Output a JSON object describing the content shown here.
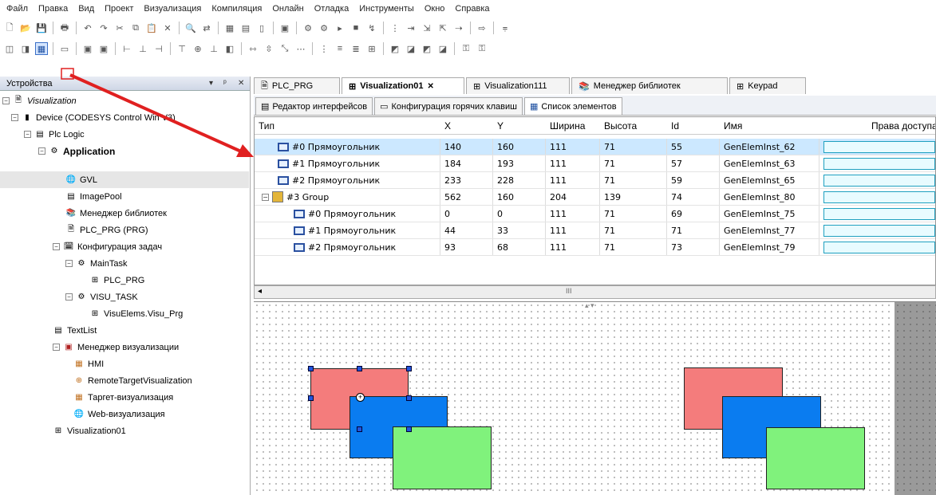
{
  "menu": [
    "Файл",
    "Правка",
    "Вид",
    "Проект",
    "Визуализация",
    "Компиляция",
    "Онлайн",
    "Отладка",
    "Инструменты",
    "Окно",
    "Справка"
  ],
  "sidebar": {
    "title": "Устройства",
    "controls": [
      "▾",
      "ᵖ",
      "✕"
    ],
    "tree": {
      "visualization": "Visualization",
      "device": "Device (CODESYS Control Win V3)",
      "plc_logic": "Plc Logic",
      "application": "Application",
      "gvl": "GVL",
      "imagepool": "ImagePool",
      "lib_manager": "Менеджер библиотек",
      "plc_prg": "PLC_PRG (PRG)",
      "task_config": "Конфигурация задач",
      "maintask": "MainTask",
      "maintask_prg": "PLC_PRG",
      "visu_task": "VISU_TASK",
      "visu_prg": "VisuElems.Visu_Prg",
      "textlist": "TextList",
      "visu_manager": "Менеджер визуализации",
      "hmi": "HMI",
      "remote_target": "RemoteTargetVisualization",
      "target_visu": "Таргет-визуализация",
      "web_visu": "Web-визуализация",
      "visualization01": "Visualization01"
    }
  },
  "tabs": [
    {
      "label": "PLC_PRG"
    },
    {
      "label": "Visualization01",
      "close": "✕"
    },
    {
      "label": "Visualization111"
    },
    {
      "label": "Менеджер библиотек"
    },
    {
      "label": "Keypad"
    }
  ],
  "subtabs": [
    {
      "label": "Редактор интерфейсов"
    },
    {
      "label": "Конфигурация горячих клавиш"
    },
    {
      "label": "Список элементов"
    }
  ],
  "table": {
    "headers": [
      "Тип",
      "X",
      "Y",
      "Ширина",
      "Высота",
      "Id",
      "Имя",
      "Права доступа"
    ],
    "rows": [
      {
        "type": "#0 Прямоугольник",
        "x": "140",
        "y": "160",
        "w": "111",
        "h": "71",
        "id": "55",
        "name": "GenElemInst_62"
      },
      {
        "type": "#1 Прямоугольник",
        "x": "184",
        "y": "193",
        "w": "111",
        "h": "71",
        "id": "57",
        "name": "GenElemInst_63"
      },
      {
        "type": "#2 Прямоугольник",
        "x": "233",
        "y": "228",
        "w": "111",
        "h": "71",
        "id": "59",
        "name": "GenElemInst_65"
      },
      {
        "type": "#3 Group",
        "x": "562",
        "y": "160",
        "w": "204",
        "h": "139",
        "id": "74",
        "name": "GenElemInst_80"
      },
      {
        "type": "#0 Прямоугольник",
        "x": "0",
        "y": "0",
        "w": "111",
        "h": "71",
        "id": "69",
        "name": "GenElemInst_75"
      },
      {
        "type": "#1 Прямоугольник",
        "x": "44",
        "y": "33",
        "w": "111",
        "h": "71",
        "id": "71",
        "name": "GenElemInst_77"
      },
      {
        "type": "#2 Прямоугольник",
        "x": "93",
        "y": "68",
        "w": "111",
        "h": "71",
        "id": "73",
        "name": "GenElemInst_79"
      }
    ],
    "scroll_mark": "III"
  },
  "colors": {
    "red": "#f47c7c",
    "blue": "#0a7cf0",
    "green": "#80f27c",
    "accent_red": "#e02020"
  }
}
